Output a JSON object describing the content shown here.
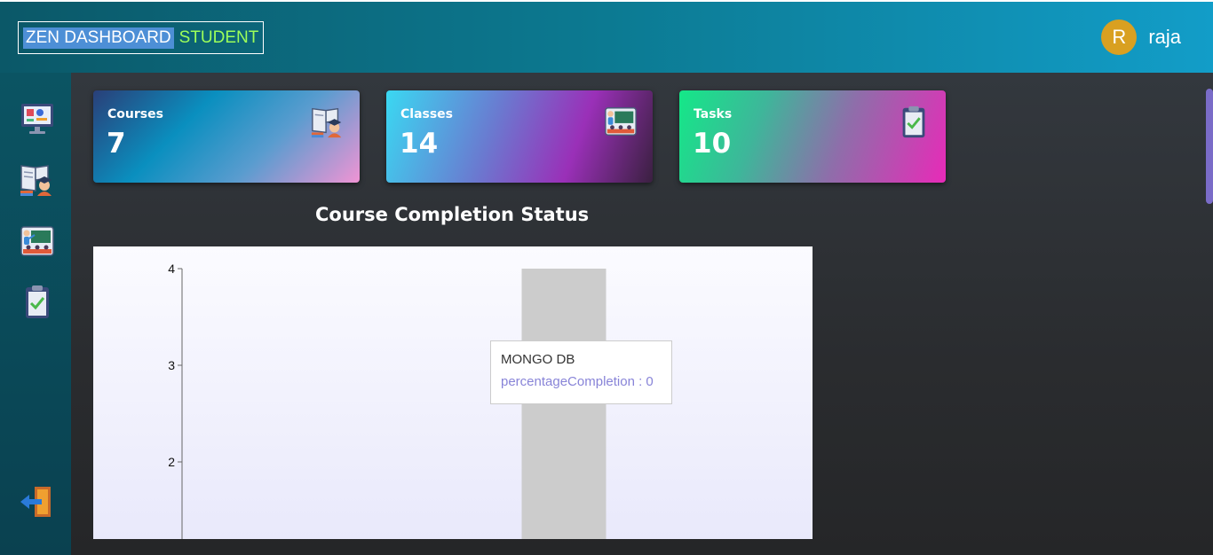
{
  "header": {
    "brand_main": "ZEN DASHBOARD",
    "brand_sub": "STUDENT",
    "avatar_initial": "R",
    "username": "raja"
  },
  "sidebar": {
    "items": [
      {
        "name": "dashboard",
        "icon": "computer-screen-icon"
      },
      {
        "name": "courses",
        "icon": "books-student-icon"
      },
      {
        "name": "classes",
        "icon": "classroom-teacher-icon"
      },
      {
        "name": "tasks",
        "icon": "clipboard-check-icon"
      },
      {
        "name": "logout",
        "icon": "logout-door-icon"
      }
    ]
  },
  "cards": [
    {
      "title": "Courses",
      "value": "7",
      "icon": "books-student-icon"
    },
    {
      "title": "Classes",
      "value": "14",
      "icon": "classroom-teacher-icon"
    },
    {
      "title": "Tasks",
      "value": "10",
      "icon": "clipboard-check-icon"
    }
  ],
  "chart_title": "Course Completion Status",
  "chart_data": {
    "type": "bar",
    "categories": [
      "MONGO DB"
    ],
    "series": [
      {
        "name": "percentageCompletion",
        "values": [
          0
        ]
      }
    ],
    "yticks": [
      2,
      3,
      4
    ],
    "ylim": [
      1.2,
      4.2
    ],
    "bar_color": "#cccccc",
    "axis_color": "#666666"
  },
  "tooltip": {
    "label": "MONGO DB",
    "item": "percentageCompletion : 0"
  },
  "colors": {
    "brand_highlight": "#4d8fd6",
    "brand_sub": "#9dff5a",
    "avatar": "#d9a021",
    "tooltip_item": "#8884d8"
  }
}
